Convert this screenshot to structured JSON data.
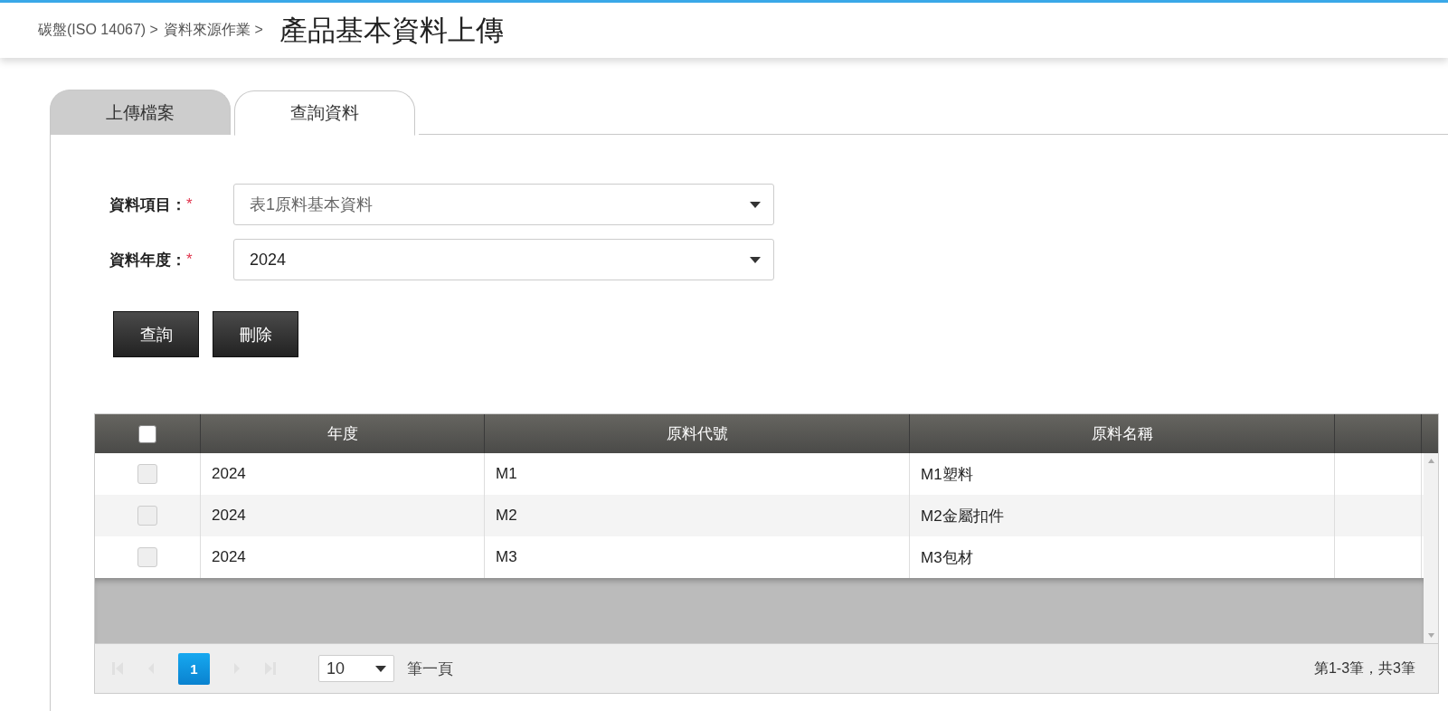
{
  "breadcrumb": [
    "碳盤(ISO 14067) >",
    "資料來源作業 >"
  ],
  "page_title": "產品基本資料上傳",
  "tabs": [
    {
      "label": "上傳檔案",
      "selected": false
    },
    {
      "label": "查詢資料",
      "selected": true
    }
  ],
  "form_fields": [
    {
      "label": "資料項目：",
      "required": true,
      "value": "表1原料基本資料",
      "kind": "placeholder"
    },
    {
      "label": "資料年度：",
      "required": true,
      "value": "2024",
      "kind": "value"
    }
  ],
  "required_mark": "*",
  "buttons": [
    "查詢",
    "刪除"
  ],
  "table": {
    "select_all_checked": false,
    "columns": [
      "年度",
      "原料代號",
      "原料名稱"
    ],
    "rows": [
      {
        "checked": false,
        "cells": [
          "2024",
          "M1",
          "M1塑料"
        ]
      },
      {
        "checked": false,
        "cells": [
          "2024",
          "M2",
          "M2金屬扣件"
        ]
      },
      {
        "checked": false,
        "cells": [
          "2024",
          "M3",
          "M3包材"
        ]
      }
    ]
  },
  "pager": {
    "pages": [
      {
        "label": "1",
        "selected": true
      }
    ],
    "page_size": "10",
    "page_size_label": "筆一頁",
    "summary": "第1-3筆，共3筆"
  }
}
